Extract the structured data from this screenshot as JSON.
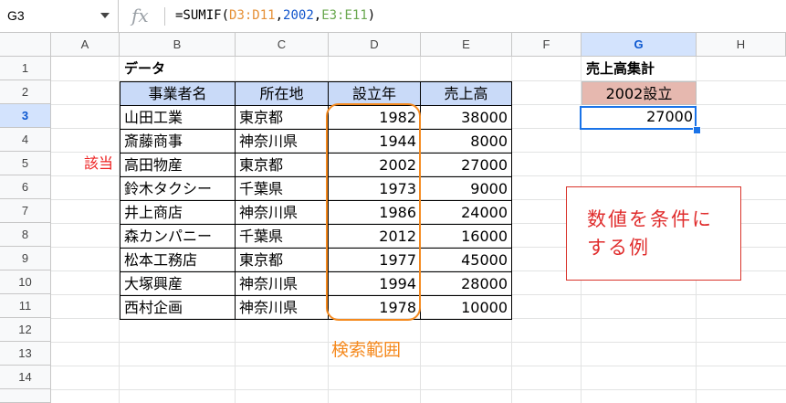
{
  "formula_bar": {
    "name_box": "G3",
    "fx": "fx",
    "formula_parts": [
      {
        "text": "=SUMIF(",
        "color": "#000000"
      },
      {
        "text": "D3:D11",
        "color": "#e69138"
      },
      {
        "text": ",",
        "color": "#000000"
      },
      {
        "text": "2002",
        "color": "#1155cc"
      },
      {
        "text": ",",
        "color": "#000000"
      },
      {
        "text": "E3:E11",
        "color": "#6aa84f"
      },
      {
        "text": ")",
        "color": "#000000"
      }
    ]
  },
  "columns": [
    "A",
    "B",
    "C",
    "D",
    "E",
    "F",
    "G",
    "H"
  ],
  "rows": [
    "1",
    "2",
    "3",
    "4",
    "5",
    "6",
    "7",
    "8",
    "9",
    "10",
    "11",
    "12",
    "13",
    "14"
  ],
  "sheet": {
    "data_title": "データ",
    "headers": [
      "事業者名",
      "所在地",
      "設立年",
      "売上高"
    ],
    "records": [
      [
        "山田工業",
        "東京都",
        "1982",
        "38000"
      ],
      [
        "斎藤商事",
        "神奈川県",
        "1944",
        "8000"
      ],
      [
        "高田物産",
        "東京都",
        "2002",
        "27000"
      ],
      [
        "鈴木タクシー",
        "千葉県",
        "1973",
        "9000"
      ],
      [
        "井上商店",
        "神奈川県",
        "1986",
        "24000"
      ],
      [
        "森カンパニー",
        "千葉県",
        "2012",
        "16000"
      ],
      [
        "松本工務店",
        "東京都",
        "1977",
        "45000"
      ],
      [
        "大塚興産",
        "神奈川県",
        "1994",
        "28000"
      ],
      [
        "西村企画",
        "神奈川県",
        "1978",
        "10000"
      ]
    ],
    "match_label": "該当",
    "summary_title": "売上高集計",
    "summary_header": "2002設立",
    "summary_value": "27000"
  },
  "annotations": {
    "search_range_label": "検索範囲",
    "note_line1": "数値を条件に",
    "note_line2": "する例"
  }
}
